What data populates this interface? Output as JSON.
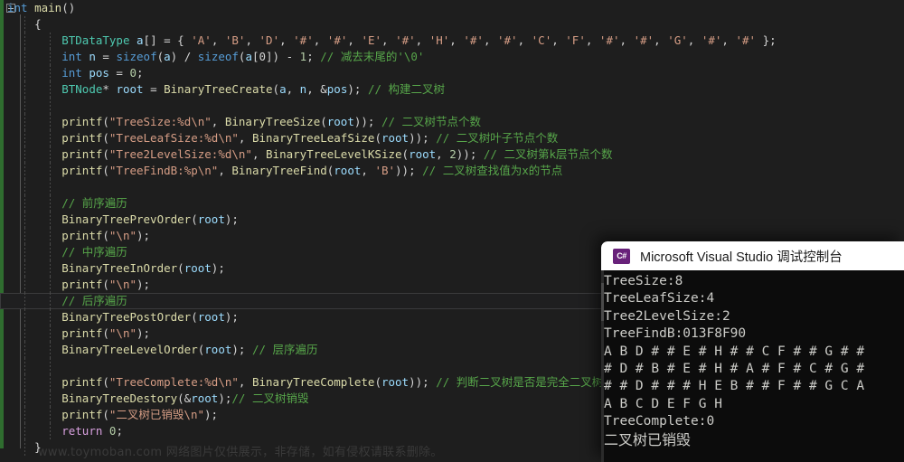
{
  "editor": {
    "theme_bg": "#1e1e1e",
    "comment_color": "#57a64a",
    "string_color": "#d69d85",
    "type_color": "#4ec9b0",
    "keyword_color": "#569cd6",
    "function_color": "#dcdcaa",
    "current_line_index": 18,
    "lines": [
      {
        "indent": 0,
        "tokens": [
          {
            "t": "kw",
            "v": "int"
          },
          {
            "t": "pun",
            "v": " "
          },
          {
            "t": "fn",
            "v": "main"
          },
          {
            "t": "pun",
            "v": "()"
          }
        ]
      },
      {
        "indent": 1,
        "tokens": [
          {
            "t": "pun",
            "v": "{"
          }
        ]
      },
      {
        "indent": 2,
        "tokens": [
          {
            "t": "typ",
            "v": "BTDataType"
          },
          {
            "t": "pun",
            "v": " "
          },
          {
            "t": "var",
            "v": "a"
          },
          {
            "t": "pun",
            "v": "[] = { "
          },
          {
            "t": "chr",
            "v": "'A'"
          },
          {
            "t": "pun",
            "v": ", "
          },
          {
            "t": "chr",
            "v": "'B'"
          },
          {
            "t": "pun",
            "v": ", "
          },
          {
            "t": "chr",
            "v": "'D'"
          },
          {
            "t": "pun",
            "v": ", "
          },
          {
            "t": "chr",
            "v": "'#'"
          },
          {
            "t": "pun",
            "v": ", "
          },
          {
            "t": "chr",
            "v": "'#'"
          },
          {
            "t": "pun",
            "v": ", "
          },
          {
            "t": "chr",
            "v": "'E'"
          },
          {
            "t": "pun",
            "v": ", "
          },
          {
            "t": "chr",
            "v": "'#'"
          },
          {
            "t": "pun",
            "v": ", "
          },
          {
            "t": "chr",
            "v": "'H'"
          },
          {
            "t": "pun",
            "v": ", "
          },
          {
            "t": "chr",
            "v": "'#'"
          },
          {
            "t": "pun",
            "v": ", "
          },
          {
            "t": "chr",
            "v": "'#'"
          },
          {
            "t": "pun",
            "v": ", "
          },
          {
            "t": "chr",
            "v": "'C'"
          },
          {
            "t": "pun",
            "v": ", "
          },
          {
            "t": "chr",
            "v": "'F'"
          },
          {
            "t": "pun",
            "v": ", "
          },
          {
            "t": "chr",
            "v": "'#'"
          },
          {
            "t": "pun",
            "v": ", "
          },
          {
            "t": "chr",
            "v": "'#'"
          },
          {
            "t": "pun",
            "v": ", "
          },
          {
            "t": "chr",
            "v": "'G'"
          },
          {
            "t": "pun",
            "v": ", "
          },
          {
            "t": "chr",
            "v": "'#'"
          },
          {
            "t": "pun",
            "v": ", "
          },
          {
            "t": "chr",
            "v": "'#'"
          },
          {
            "t": "pun",
            "v": " };"
          }
        ]
      },
      {
        "indent": 2,
        "tokens": [
          {
            "t": "kw",
            "v": "int"
          },
          {
            "t": "pun",
            "v": " "
          },
          {
            "t": "var",
            "v": "n"
          },
          {
            "t": "pun",
            "v": " = "
          },
          {
            "t": "kw",
            "v": "sizeof"
          },
          {
            "t": "pun",
            "v": "("
          },
          {
            "t": "var",
            "v": "a"
          },
          {
            "t": "pun",
            "v": ") / "
          },
          {
            "t": "kw",
            "v": "sizeof"
          },
          {
            "t": "pun",
            "v": "("
          },
          {
            "t": "var",
            "v": "a"
          },
          {
            "t": "pun",
            "v": "[0]) - "
          },
          {
            "t": "num",
            "v": "1"
          },
          {
            "t": "pun",
            "v": "; "
          },
          {
            "t": "cmt",
            "v": "// 减去末尾的'\\0'"
          }
        ]
      },
      {
        "indent": 2,
        "tokens": [
          {
            "t": "kw",
            "v": "int"
          },
          {
            "t": "pun",
            "v": " "
          },
          {
            "t": "var",
            "v": "pos"
          },
          {
            "t": "pun",
            "v": " = "
          },
          {
            "t": "num",
            "v": "0"
          },
          {
            "t": "pun",
            "v": ";"
          }
        ]
      },
      {
        "indent": 2,
        "tokens": [
          {
            "t": "typ",
            "v": "BTNode"
          },
          {
            "t": "pun",
            "v": "* "
          },
          {
            "t": "var",
            "v": "root"
          },
          {
            "t": "pun",
            "v": " = "
          },
          {
            "t": "fn",
            "v": "BinaryTreeCreate"
          },
          {
            "t": "pun",
            "v": "("
          },
          {
            "t": "var",
            "v": "a"
          },
          {
            "t": "pun",
            "v": ", "
          },
          {
            "t": "var",
            "v": "n"
          },
          {
            "t": "pun",
            "v": ", &"
          },
          {
            "t": "var",
            "v": "pos"
          },
          {
            "t": "pun",
            "v": "); "
          },
          {
            "t": "cmt",
            "v": "// 构建二叉树"
          }
        ]
      },
      {
        "indent": 2,
        "tokens": []
      },
      {
        "indent": 2,
        "tokens": [
          {
            "t": "fn",
            "v": "printf"
          },
          {
            "t": "pun",
            "v": "("
          },
          {
            "t": "str",
            "v": "\"TreeSize:%d\\n\""
          },
          {
            "t": "pun",
            "v": ", "
          },
          {
            "t": "fn",
            "v": "BinaryTreeSize"
          },
          {
            "t": "pun",
            "v": "("
          },
          {
            "t": "var",
            "v": "root"
          },
          {
            "t": "pun",
            "v": ")); "
          },
          {
            "t": "cmt",
            "v": "// 二叉树节点个数"
          }
        ]
      },
      {
        "indent": 2,
        "tokens": [
          {
            "t": "fn",
            "v": "printf"
          },
          {
            "t": "pun",
            "v": "("
          },
          {
            "t": "str",
            "v": "\"TreeLeafSize:%d\\n\""
          },
          {
            "t": "pun",
            "v": ", "
          },
          {
            "t": "fn",
            "v": "BinaryTreeLeafSize"
          },
          {
            "t": "pun",
            "v": "("
          },
          {
            "t": "var",
            "v": "root"
          },
          {
            "t": "pun",
            "v": ")); "
          },
          {
            "t": "cmt",
            "v": "// 二叉树叶子节点个数"
          }
        ]
      },
      {
        "indent": 2,
        "tokens": [
          {
            "t": "fn",
            "v": "printf"
          },
          {
            "t": "pun",
            "v": "("
          },
          {
            "t": "str",
            "v": "\"Tree2LevelSize:%d\\n\""
          },
          {
            "t": "pun",
            "v": ", "
          },
          {
            "t": "fn",
            "v": "BinaryTreeLevelKSize"
          },
          {
            "t": "pun",
            "v": "("
          },
          {
            "t": "var",
            "v": "root"
          },
          {
            "t": "pun",
            "v": ", "
          },
          {
            "t": "num",
            "v": "2"
          },
          {
            "t": "pun",
            "v": ")); "
          },
          {
            "t": "cmt",
            "v": "// 二叉树第k层节点个数"
          }
        ]
      },
      {
        "indent": 2,
        "tokens": [
          {
            "t": "fn",
            "v": "printf"
          },
          {
            "t": "pun",
            "v": "("
          },
          {
            "t": "str",
            "v": "\"TreeFindB:%p\\n\""
          },
          {
            "t": "pun",
            "v": ", "
          },
          {
            "t": "fn",
            "v": "BinaryTreeFind"
          },
          {
            "t": "pun",
            "v": "("
          },
          {
            "t": "var",
            "v": "root"
          },
          {
            "t": "pun",
            "v": ", "
          },
          {
            "t": "chr",
            "v": "'B'"
          },
          {
            "t": "pun",
            "v": ")); "
          },
          {
            "t": "cmt",
            "v": "// 二叉树查找值为x的节点"
          }
        ]
      },
      {
        "indent": 2,
        "tokens": []
      },
      {
        "indent": 2,
        "tokens": [
          {
            "t": "cmt",
            "v": "// 前序遍历"
          }
        ]
      },
      {
        "indent": 2,
        "tokens": [
          {
            "t": "fn",
            "v": "BinaryTreePrevOrder"
          },
          {
            "t": "pun",
            "v": "("
          },
          {
            "t": "var",
            "v": "root"
          },
          {
            "t": "pun",
            "v": ");"
          }
        ]
      },
      {
        "indent": 2,
        "tokens": [
          {
            "t": "fn",
            "v": "printf"
          },
          {
            "t": "pun",
            "v": "("
          },
          {
            "t": "str",
            "v": "\"\\n\""
          },
          {
            "t": "pun",
            "v": ");"
          }
        ]
      },
      {
        "indent": 2,
        "tokens": [
          {
            "t": "cmt",
            "v": "// 中序遍历"
          }
        ]
      },
      {
        "indent": 2,
        "tokens": [
          {
            "t": "fn",
            "v": "BinaryTreeInOrder"
          },
          {
            "t": "pun",
            "v": "("
          },
          {
            "t": "var",
            "v": "root"
          },
          {
            "t": "pun",
            "v": ");"
          }
        ]
      },
      {
        "indent": 2,
        "tokens": [
          {
            "t": "fn",
            "v": "printf"
          },
          {
            "t": "pun",
            "v": "("
          },
          {
            "t": "str",
            "v": "\"\\n\""
          },
          {
            "t": "pun",
            "v": ");"
          }
        ]
      },
      {
        "indent": 2,
        "tokens": [
          {
            "t": "cmt",
            "v": "// 后序遍历"
          }
        ]
      },
      {
        "indent": 2,
        "tokens": [
          {
            "t": "fn",
            "v": "BinaryTreePostOrder"
          },
          {
            "t": "pun",
            "v": "("
          },
          {
            "t": "var",
            "v": "root"
          },
          {
            "t": "pun",
            "v": ");"
          }
        ]
      },
      {
        "indent": 2,
        "tokens": [
          {
            "t": "fn",
            "v": "printf"
          },
          {
            "t": "pun",
            "v": "("
          },
          {
            "t": "str",
            "v": "\"\\n\""
          },
          {
            "t": "pun",
            "v": ");"
          }
        ]
      },
      {
        "indent": 2,
        "tokens": [
          {
            "t": "fn",
            "v": "BinaryTreeLevelOrder"
          },
          {
            "t": "pun",
            "v": "("
          },
          {
            "t": "var",
            "v": "root"
          },
          {
            "t": "pun",
            "v": "); "
          },
          {
            "t": "cmt",
            "v": "// 层序遍历"
          }
        ]
      },
      {
        "indent": 2,
        "tokens": []
      },
      {
        "indent": 2,
        "tokens": [
          {
            "t": "fn",
            "v": "printf"
          },
          {
            "t": "pun",
            "v": "("
          },
          {
            "t": "str",
            "v": "\"TreeComplete:%d\\n\""
          },
          {
            "t": "pun",
            "v": ", "
          },
          {
            "t": "fn",
            "v": "BinaryTreeComplete"
          },
          {
            "t": "pun",
            "v": "("
          },
          {
            "t": "var",
            "v": "root"
          },
          {
            "t": "pun",
            "v": ")); "
          },
          {
            "t": "cmt",
            "v": "// 判断二叉树是否是完全二叉树"
          }
        ]
      },
      {
        "indent": 2,
        "tokens": [
          {
            "t": "fn",
            "v": "BinaryTreeDestory"
          },
          {
            "t": "pun",
            "v": "(&"
          },
          {
            "t": "var",
            "v": "root"
          },
          {
            "t": "pun",
            "v": ");"
          },
          {
            "t": "cmt",
            "v": "// 二叉树销毁"
          }
        ]
      },
      {
        "indent": 2,
        "tokens": [
          {
            "t": "fn",
            "v": "printf"
          },
          {
            "t": "pun",
            "v": "("
          },
          {
            "t": "str",
            "v": "\"二叉树已销毁\\n\""
          },
          {
            "t": "pun",
            "v": ");"
          }
        ]
      },
      {
        "indent": 2,
        "tokens": [
          {
            "t": "kwp",
            "v": "return"
          },
          {
            "t": "pun",
            "v": " "
          },
          {
            "t": "num",
            "v": "0"
          },
          {
            "t": "pun",
            "v": ";"
          }
        ]
      },
      {
        "indent": 1,
        "tokens": [
          {
            "t": "pun",
            "v": "}"
          }
        ]
      }
    ]
  },
  "console": {
    "title": "Microsoft Visual Studio 调试控制台",
    "icon_label": "C#",
    "icon_color": "#68217a",
    "background": "#0c0c0c",
    "text_color": "#ccccc8",
    "output_lines": [
      {
        "text": "TreeSize:8",
        "cjk": false
      },
      {
        "text": "TreeLeafSize:4",
        "cjk": false
      },
      {
        "text": "Tree2LevelSize:2",
        "cjk": false
      },
      {
        "text": "TreeFindB:013F8F90",
        "cjk": false
      },
      {
        "text": "A B D # # E # H # # C F # # G # #",
        "cjk": false
      },
      {
        "text": "# D # B # E # H # A # F # C # G #",
        "cjk": false
      },
      {
        "text": "# # D # # # H E B # # F # # G C A",
        "cjk": false
      },
      {
        "text": "A B C D E F G H",
        "cjk": false
      },
      {
        "text": "TreeComplete:0",
        "cjk": false
      },
      {
        "text": "二叉树已销毁",
        "cjk": true
      }
    ]
  },
  "watermark": {
    "text": "www.toymoban.com 网络图片仅供展示，非存储，如有侵权请联系删除。"
  }
}
